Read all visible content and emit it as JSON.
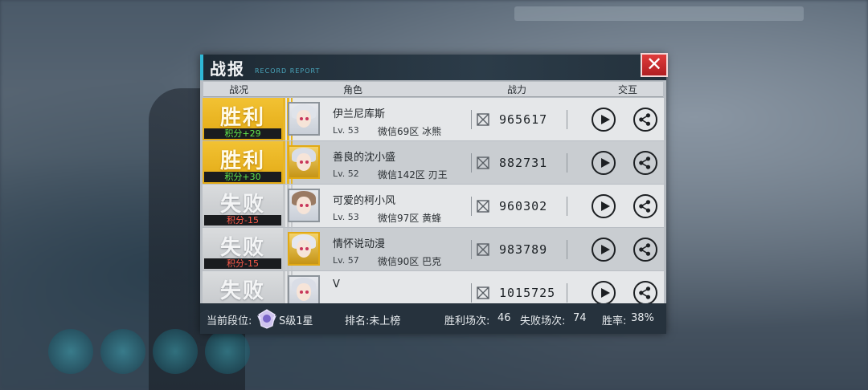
{
  "dialog": {
    "title": "战报",
    "subtitle": "RECORD REPORT",
    "close_icon": "close-icon"
  },
  "columns": {
    "status": "战况",
    "role": "角色",
    "power": "战力",
    "interact": "交互"
  },
  "records": [
    {
      "result": "胜利",
      "outcome": "win",
      "score": "积分+29",
      "name": "伊兰尼库斯",
      "level": "Lv. 53",
      "server": "微信69区 冰熊",
      "power": "965617",
      "avatar_frame": "plain",
      "hair_color": "#dfe3ea"
    },
    {
      "result": "胜利",
      "outcome": "win",
      "score": "积分+30",
      "name": "善良的沈小盛",
      "level": "Lv. 52",
      "server": "微信142区 刃王",
      "power": "882731",
      "avatar_frame": "gold",
      "hair_color": "#d9dde6"
    },
    {
      "result": "失败",
      "outcome": "lose",
      "score": "积分-15",
      "name": "可爱的柯小风",
      "level": "Lv. 53",
      "server": "微信97区 黄蜂",
      "power": "960302",
      "avatar_frame": "plain",
      "hair_color": "#9a7a63"
    },
    {
      "result": "失败",
      "outcome": "lose",
      "score": "积分-15",
      "name": "情怀说动漫",
      "level": "Lv. 57",
      "server": "微信90区 巴克",
      "power": "983789",
      "avatar_frame": "gold",
      "hair_color": "#e5e7ee"
    },
    {
      "result": "失败",
      "outcome": "lose",
      "score": "",
      "name": "V",
      "level": "",
      "server": "",
      "power": "1015725",
      "avatar_frame": "plain",
      "hair_color": "#d9dde6"
    }
  ],
  "footer": {
    "rank_label": "当前段位:",
    "rank_value": "S级1星",
    "leaderboard": "排名:未上榜",
    "wins_label": "胜利场次:",
    "wins": "46",
    "losses_label": "失败场次:",
    "losses": "74",
    "win_rate_label": "胜率:",
    "win_rate": "38%"
  },
  "colors": {
    "win": "#f2c233",
    "lose": "#dadcde",
    "accent": "#2fb8d6",
    "close": "#e03c3c"
  }
}
